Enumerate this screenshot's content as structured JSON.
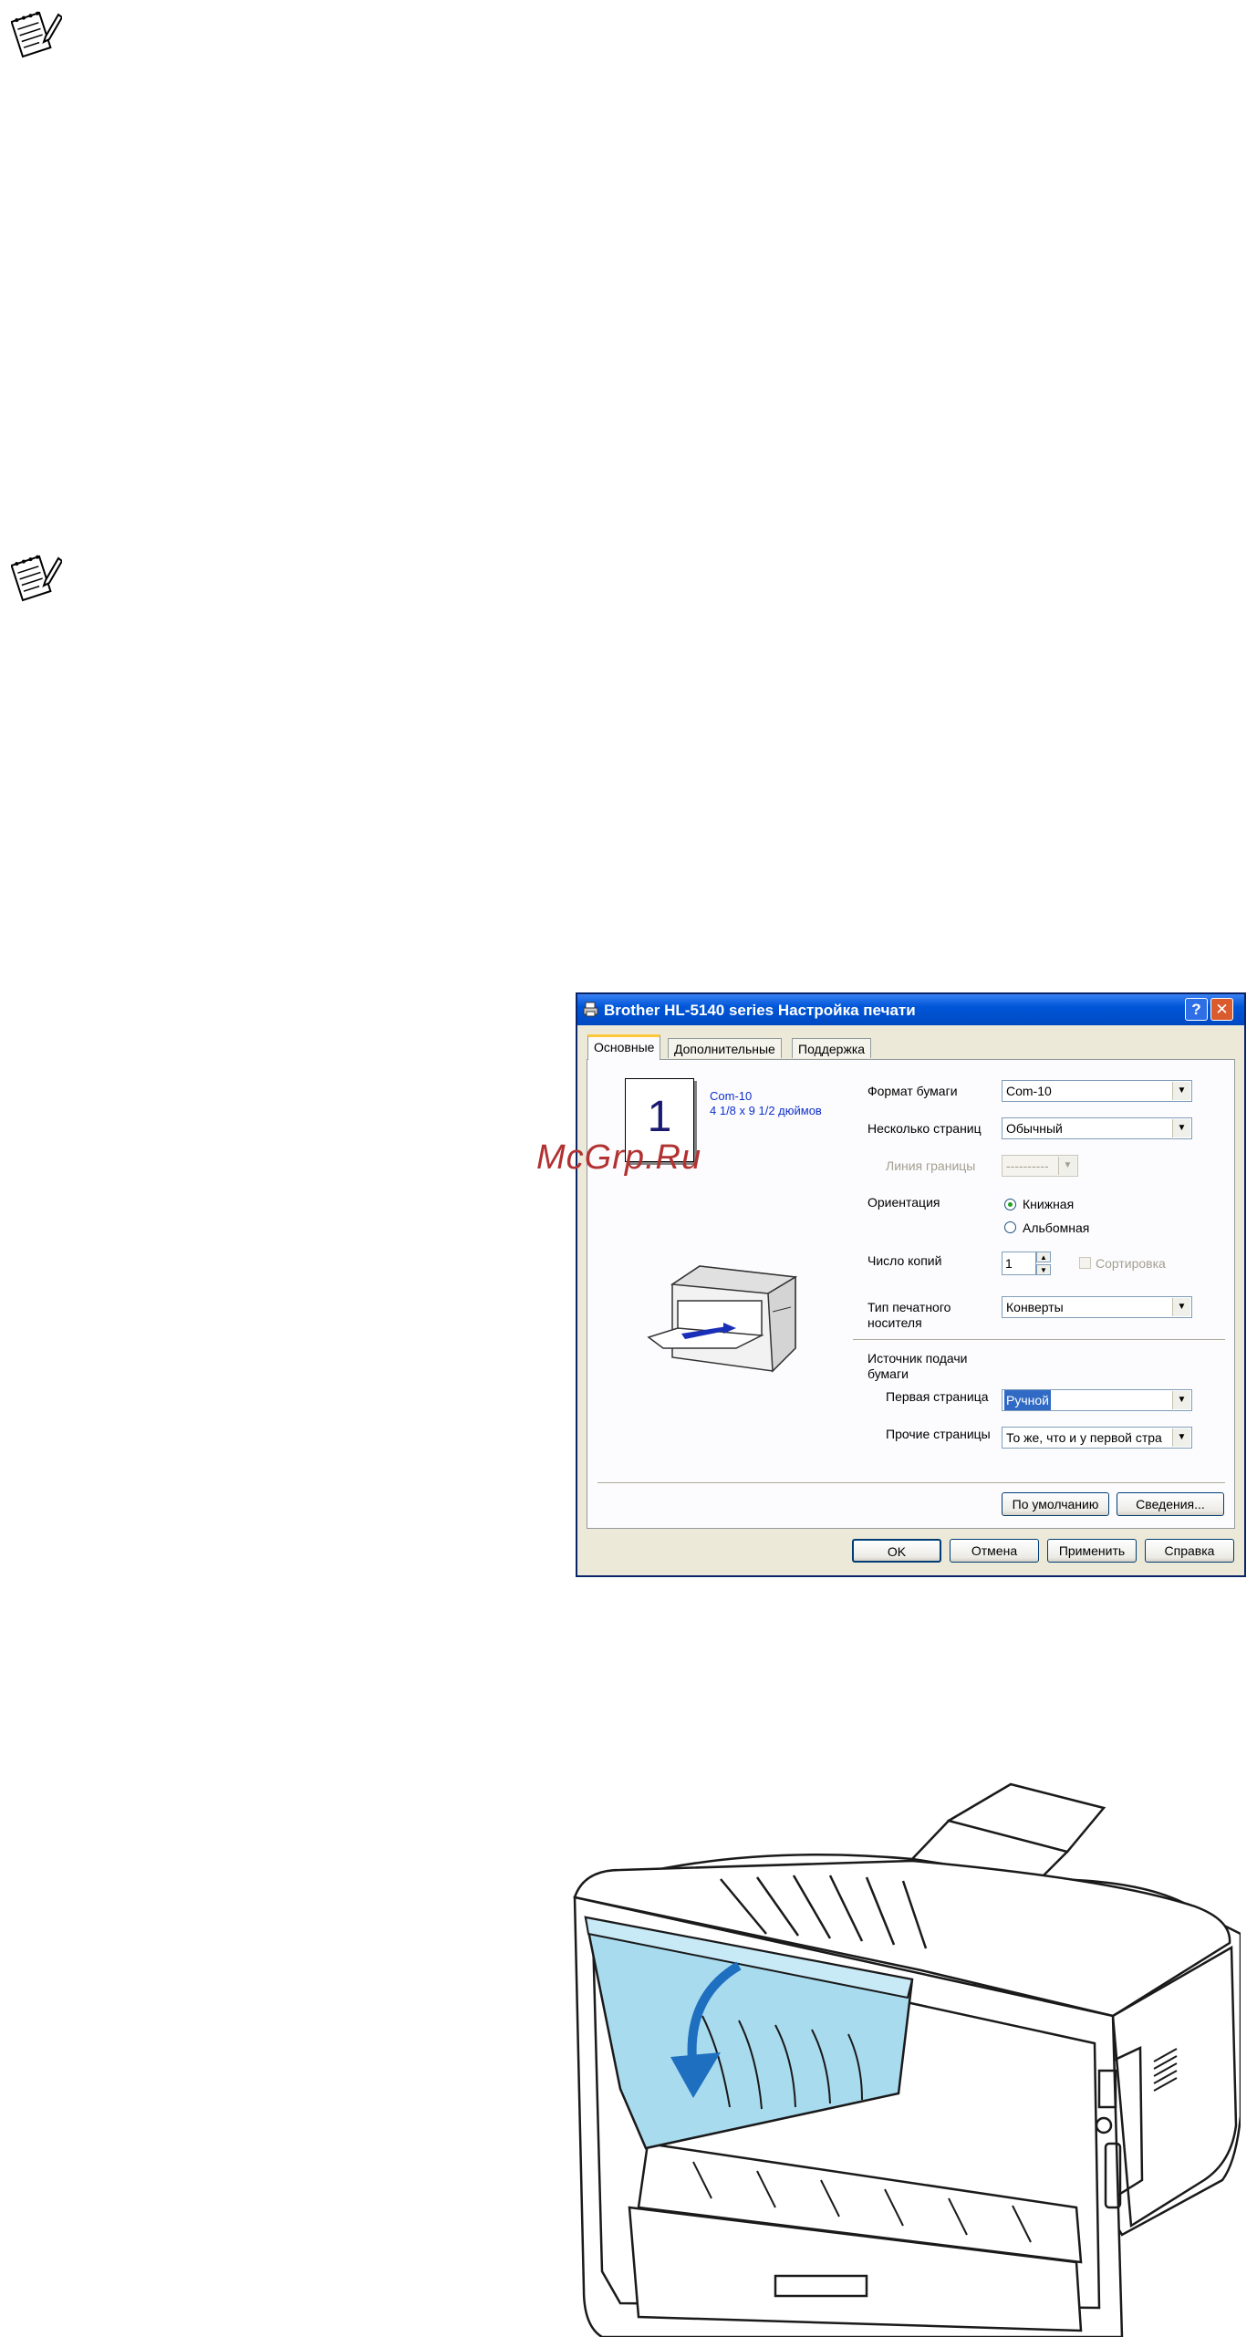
{
  "watermark": "McGrp.Ru",
  "dialog": {
    "title": "Brother HL-5140 series Настройка печати",
    "help_button": "?",
    "close_button": "✕",
    "tabs": [
      {
        "label": "Основные",
        "active": true
      },
      {
        "label": "Дополнительные",
        "active": false
      },
      {
        "label": "Поддержка",
        "active": false
      }
    ],
    "preview": {
      "page_number": "1",
      "paper_name": "Com-10",
      "paper_size": "4 1/8 x 9 1/2 дюймов"
    },
    "paper_size": {
      "label": "Формат бумаги",
      "value": "Com-10"
    },
    "multiple_page": {
      "label": "Несколько страниц",
      "value": "Обычный"
    },
    "border_line": {
      "label": "Линия границы",
      "value": "----------"
    },
    "orientation": {
      "label": "Ориентация",
      "options": [
        {
          "label": "Книжная",
          "selected": true
        },
        {
          "label": "Альбомная",
          "selected": false
        }
      ]
    },
    "copies": {
      "label": "Число копий",
      "value": "1",
      "collate_label": "Сортировка"
    },
    "media_type": {
      "label_line1": "Тип печатного",
      "label_line2": "носителя",
      "value": "Конверты"
    },
    "paper_source": {
      "label_line1": "Источник подачи",
      "label_line2": "бумаги",
      "first_page": {
        "label": "Первая страница",
        "value": "Ручной"
      },
      "other_pages": {
        "label": "Прочие страницы",
        "value": "То же, что и у первой стра"
      }
    },
    "default_button": "По умолчанию",
    "about_button": "Сведения...",
    "ok_button": "OK",
    "cancel_button": "Отмена",
    "apply_button": "Применить",
    "help_btn": "Справка"
  },
  "colors": {
    "titlebar": "#0054e3",
    "window_bg": "#ece9d8",
    "rear_cover": "#a9dbef",
    "watermark": "#b23131"
  }
}
